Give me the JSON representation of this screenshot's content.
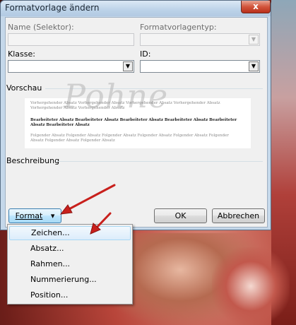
{
  "window": {
    "title": "Formatvorlage ändern",
    "close_glyph": "x"
  },
  "form": {
    "name_label": "Name (Selektor):",
    "name_value": "",
    "style_type_label": "Formatvorlagentyp:",
    "style_type_value": "",
    "class_label": "Klasse:",
    "class_value": "",
    "id_label": "ID:",
    "id_value": ""
  },
  "preview": {
    "section_label": "Vorschau",
    "watermark": "Pohne",
    "previous_paragraph": "Vorhergehender Absatz Vorhergehender Absatz Vorhergehender Absatz Vorhergehender Absatz Vorhergehender Absatz Vorhergehender Absatz",
    "edited_paragraph": "Bearbeiteter Absatz Bearbeiteter Absatz Bearbeiteter Absatz Bearbeiteter Absatz Bearbeiteter Absatz Bearbeiteter Absatz",
    "next_paragraph": "Folgender Absatz Folgender Absatz Folgender Absatz Folgender Absatz Folgender Absatz Folgender Absatz Folgender Absatz Folgender Absatz"
  },
  "description": {
    "section_label": "Beschreibung"
  },
  "buttons": {
    "format_label": "Format",
    "format_arrow": "▾",
    "ok_label": "OK",
    "cancel_label": "Abbrechen"
  },
  "format_menu": {
    "items": [
      {
        "label": "Zeichen..."
      },
      {
        "label": "Absatz..."
      },
      {
        "label": "Rahmen..."
      },
      {
        "label": "Nummerierung..."
      },
      {
        "label": "Position..."
      }
    ],
    "highlighted_index": 0
  },
  "colors": {
    "arrow_red": "#c8201c",
    "titlebar": "#c5d8ea",
    "highlight": "#dcecfb"
  }
}
